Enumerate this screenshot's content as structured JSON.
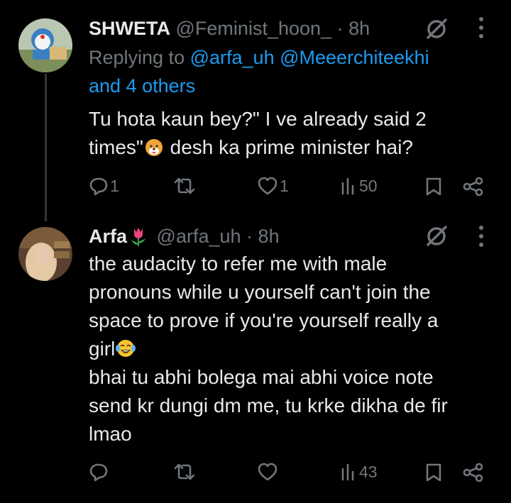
{
  "tweets": [
    {
      "name": "SHWETA",
      "handle": "@Feminist_hoon_",
      "separator": "·",
      "time": "8h",
      "replying_prefix": "Replying to",
      "replying_handles": "@arfa_uh @Meeerchiteekhi",
      "replying_more": "and 4 others",
      "text_line1": "Tu hota kaun bey?\" I ve already said 2",
      "text_line2_a": "times\"",
      "text_line2_b": " desh ka prime minister hai?",
      "reply_count": "1",
      "retweet_count": "",
      "like_count": "1",
      "view_count": "50"
    },
    {
      "name": "Arfa",
      "handle": "@arfa_uh",
      "separator": "·",
      "time": "8h",
      "text_line1": "the audacity to refer me with male",
      "text_line2": "pronouns while u yourself can't join the",
      "text_line3": "space to prove if you're yourself really a",
      "text_line4": "girl",
      "text_line5": "bhai tu abhi bolega mai abhi voice note",
      "text_line6": "send kr dungi dm me, tu krke dikha de fir",
      "text_line7": "lmao",
      "reply_count": "",
      "retweet_count": "",
      "like_count": "",
      "view_count": "43"
    }
  ],
  "colors": {
    "background": "#000000",
    "text": "#e7e9ea",
    "muted": "#71767b",
    "link": "#1d9bf0"
  },
  "icons": [
    "reply-icon",
    "retweet-icon",
    "like-icon",
    "views-icon",
    "bookmark-icon",
    "share-icon",
    "grok-icon",
    "more-icon",
    "dog-emoji",
    "tulip-emoji",
    "laughing-emoji"
  ]
}
